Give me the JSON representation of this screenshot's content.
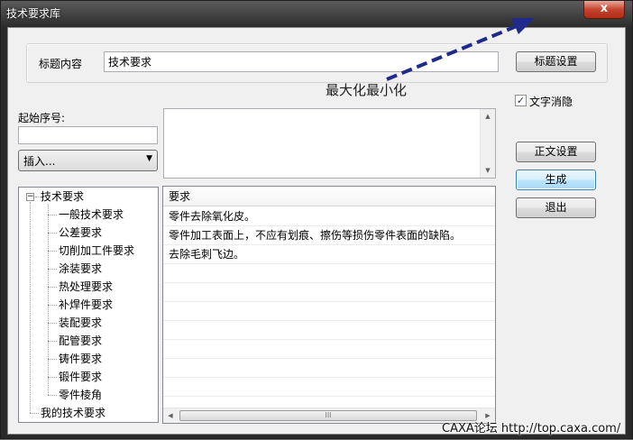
{
  "window": {
    "title": "技术要求库",
    "close_symbol": "x"
  },
  "title_group": {
    "label": "标题内容",
    "value": "技术要求",
    "settings_button": "标题设置"
  },
  "checkbox_hide_text": {
    "label": "文字消隐",
    "checked": true,
    "mark": "✓"
  },
  "start_number": {
    "label": "起始序号:",
    "value": ""
  },
  "insert_combo": {
    "value": "插入...",
    "arrow": "▼"
  },
  "buttons": {
    "body_settings": "正文设置",
    "generate": "生成",
    "exit": "退出"
  },
  "tree": {
    "expander": "−",
    "root": "技术要求",
    "children": [
      "一般技术要求",
      "公差要求",
      "切削加工件要求",
      "涂装要求",
      "热处理要求",
      "补焊件要求",
      "装配要求",
      "配管要求",
      "铸件要求",
      "锻件要求",
      "零件棱角"
    ],
    "my_requirements": "我的技术要求"
  },
  "requirements_table": {
    "header": "要求",
    "rows": [
      "零件去除氧化皮。",
      "零件加工表面上，不应有划痕、擦伤等损伤零件表面的缺陷。",
      "去除毛刺飞边。"
    ]
  },
  "scroll_glyphs": {
    "up": "▲",
    "down": "▼",
    "left": "◀",
    "right": "▶",
    "grip": "III"
  },
  "annotation": {
    "text": "最大化最小化",
    "arrow_color": "#1f2a8c"
  },
  "watermark": "CAXA论坛 http://top.caxa.com/"
}
